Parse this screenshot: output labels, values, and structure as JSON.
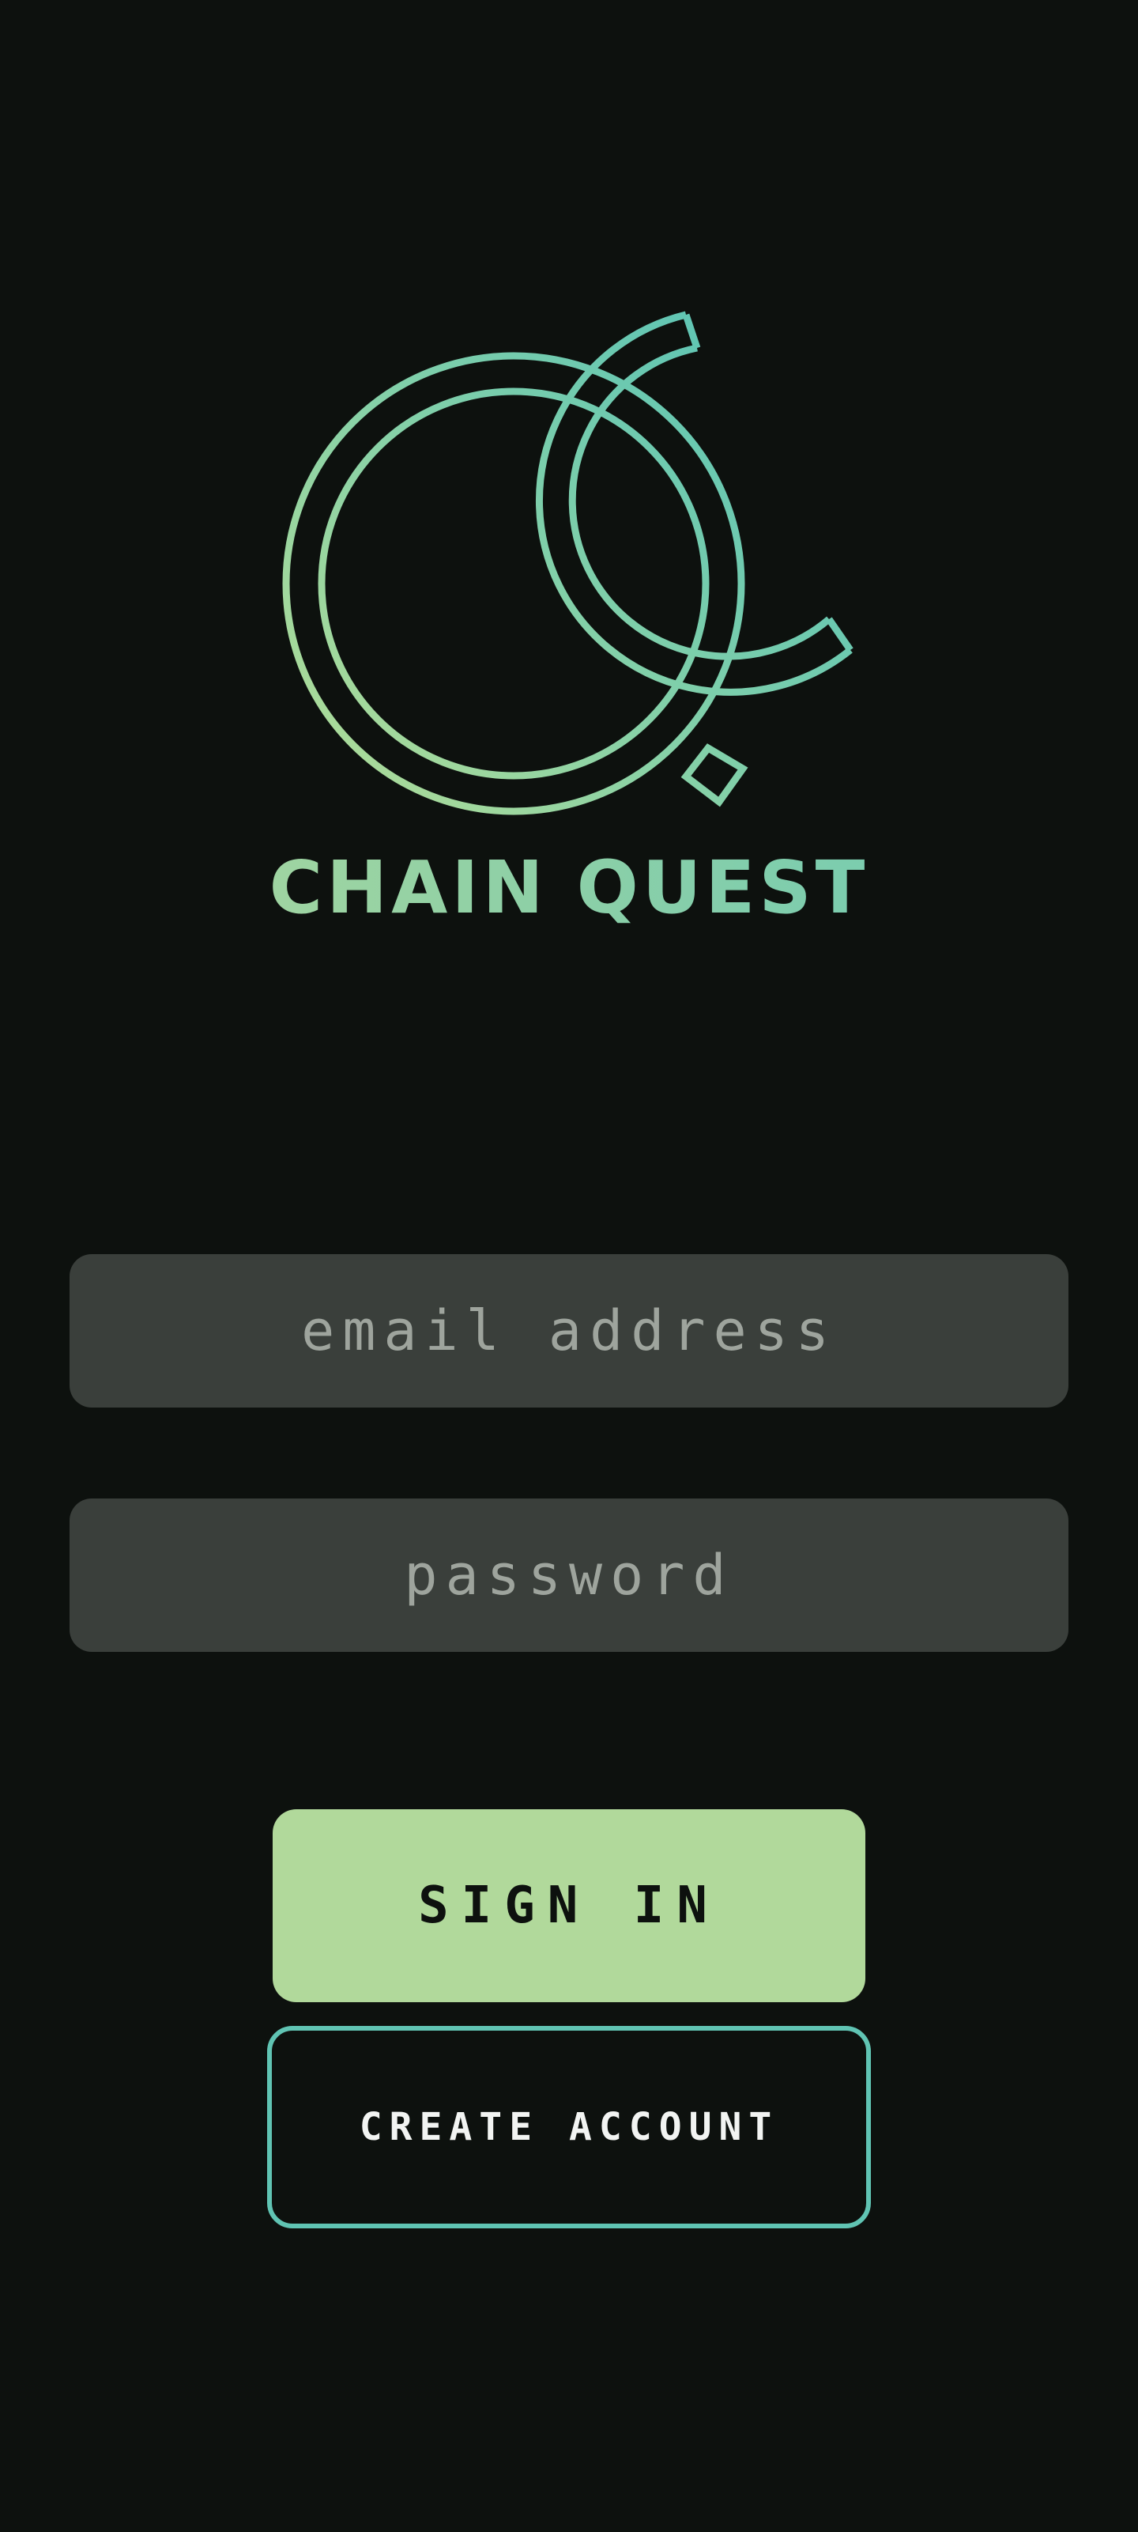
{
  "app": {
    "title": "CHAIN QUEST",
    "logo_icon": "chain-quest-logo-icon"
  },
  "form": {
    "email_placeholder": "email address",
    "password_placeholder": "password"
  },
  "buttons": {
    "sign_in_label": "SIGN IN",
    "create_account_label": "CREATE ACCOUNT"
  },
  "colors": {
    "background": "#0d110e",
    "field_background": "#3a3f3b",
    "primary_green": "#b1d99b",
    "accent_teal": "#60c4b3",
    "placeholder_text": "#9ea49d"
  }
}
